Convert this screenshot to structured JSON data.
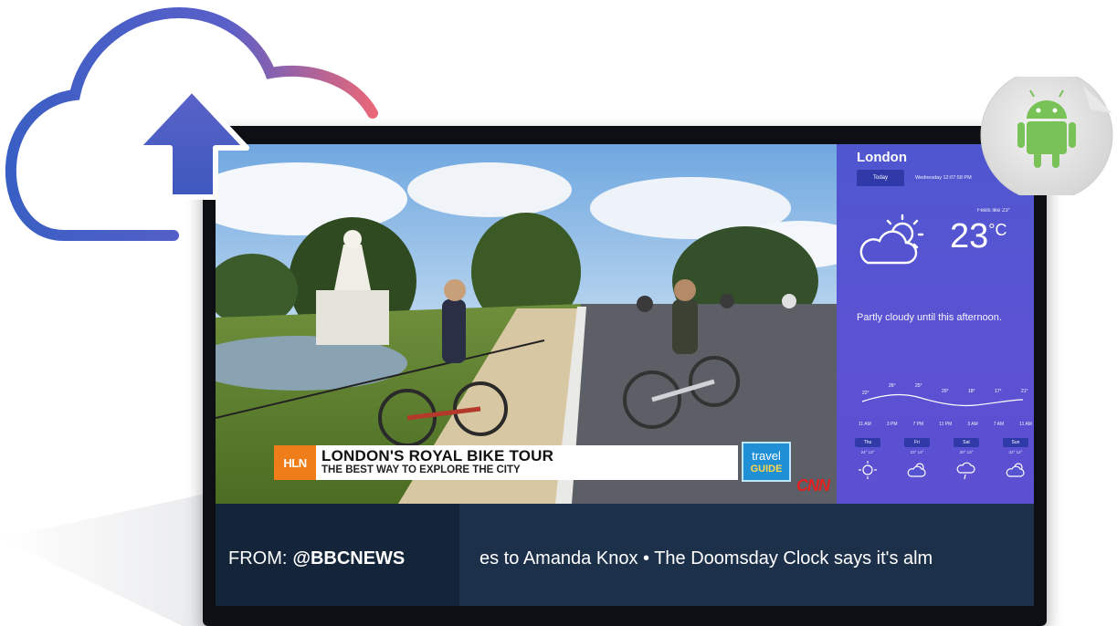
{
  "video": {
    "channel_badge": "HLN",
    "headline": "LONDON'S ROYAL BIKE TOUR",
    "subheadline": "THE BEST WAY TO EXPLORE THE CITY",
    "show_logo_line1": "travel",
    "show_logo_line2": "GUIDE",
    "network_logo": "CNN"
  },
  "weather": {
    "city": "London",
    "today_label": "Today",
    "datetime": "Wednesday 12:07:58 PM",
    "feels_like": "Feels like 23°",
    "temperature": "23",
    "unit": "°C",
    "summary": "Partly cloudy until this afternoon.",
    "condition_icon": "partly-cloudy-icon",
    "hourly_temps": [
      "22°",
      "26°",
      "25°",
      "20°",
      "18°",
      "17°",
      "21°"
    ],
    "hours": [
      "11 AM",
      "3 PM",
      "7 PM",
      "11 PM",
      "3 AM",
      "7 AM",
      "11 AM"
    ],
    "days": [
      {
        "label": "Thu",
        "temps": "24° 13°",
        "icon": "sun-icon"
      },
      {
        "label": "Fri",
        "temps": "23° 14°",
        "icon": "partly-cloudy-icon"
      },
      {
        "label": "Sat",
        "temps": "20° 13°",
        "icon": "rain-icon"
      },
      {
        "label": "Sun",
        "temps": "22° 12°",
        "icon": "partly-cloudy-icon"
      }
    ]
  },
  "ticker": {
    "source_prefix": "FROM:",
    "source_handle": "@BBCNEWS",
    "text": "es to Amanda Knox  •  The Doomsday Clock says it's alm"
  },
  "colors": {
    "weather_bg": "#5552d0",
    "ticker_bg": "#1d3049",
    "ticker_source_bg": "#14253a",
    "hln_orange": "#ef7d1a",
    "cloud_gradient_start": "#3a5fc4",
    "cloud_gradient_end": "#e8677a",
    "android_green": "#78c257"
  }
}
